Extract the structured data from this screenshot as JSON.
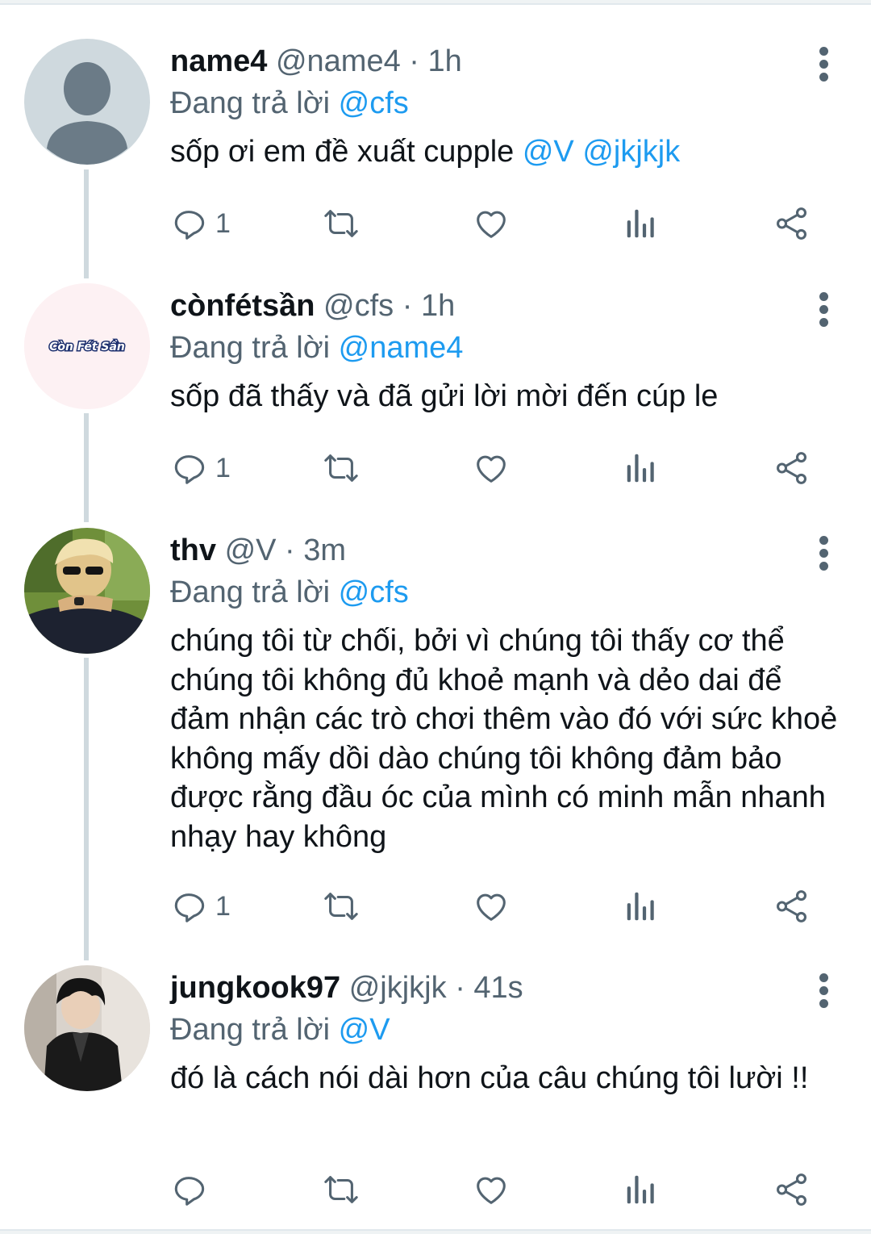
{
  "tweets": [
    {
      "name": "name4",
      "handle": "@name4",
      "sep": "·",
      "time": "1h",
      "reply_prefix": "Đang trả lời",
      "reply_to": "@cfs",
      "text": "sốp ơi em đề xuất cupple",
      "mention_1": "@V",
      "mention_2": "@jkjkjk",
      "reply_count": "1",
      "avatar": "default-profile-avatar"
    },
    {
      "name": "cònfétsần",
      "handle": "@cfs",
      "sep": "·",
      "time": "1h",
      "reply_prefix": "Đang trả lời",
      "reply_to": "@name4",
      "text": "sốp đã thấy và đã gửi lời mời đến cúp le",
      "reply_count": "1",
      "avatar_text": "Còn Fét Sần"
    },
    {
      "name": "thv",
      "handle": "@V",
      "sep": "·",
      "time": "3m",
      "reply_prefix": "Đang trả lời",
      "reply_to": "@cfs",
      "text": "chúng tôi từ chối, bởi vì chúng tôi thấy cơ thể chúng tôi không đủ khoẻ mạnh và dẻo dai để đảm nhận các trò chơi thêm vào đó với sức khoẻ không mấy dồi dào chúng tôi không đảm bảo được rằng đầu óc của mình có minh mẫn nhanh nhạy hay không",
      "reply_count": "1",
      "avatar": "photo-avatar-blond-sunglasses"
    },
    {
      "name": "jungkook97",
      "handle": "@jkjkjk",
      "sep": "·",
      "time": "41s",
      "reply_prefix": "Đang trả lời",
      "reply_to": "@V",
      "text": "đó là cách nói dài hơn của câu chúng tôi lười !!",
      "reply_count": "",
      "avatar": "photo-avatar-leather-jacket"
    }
  ],
  "icons": {
    "reply": "reply-icon",
    "retweet": "retweet-icon",
    "like": "heart-icon",
    "views": "analytics-icon",
    "share": "share-icon",
    "more": "more-options-icon"
  },
  "colors": {
    "accent": "#1d9bf0",
    "secondary_text": "#536471",
    "primary_text": "#0f1419",
    "thread_line": "#cfd9de"
  }
}
